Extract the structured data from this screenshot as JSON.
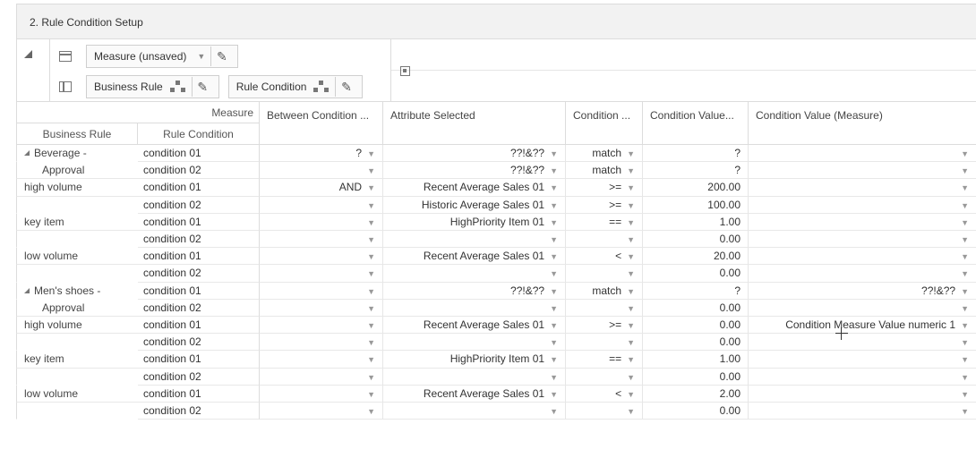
{
  "panel": {
    "title": "2. Rule Condition Setup"
  },
  "pivot": {
    "measure_chip": "Measure (unsaved)",
    "business_rule_chip": "Business Rule",
    "rule_condition_chip": "Rule Condition"
  },
  "header": {
    "measure_label": "Measure",
    "business_rule_label": "Business Rule",
    "rule_condition_label": "Rule Condition",
    "columns": [
      "Between Condition ...",
      "Attribute Selected",
      "Condition ...",
      "Condition Value...",
      "Condition Value (Measure)"
    ]
  },
  "rows": [
    {
      "br": "Beverage -",
      "expand": true,
      "rc": "condition 01",
      "v": [
        "?",
        "??!&??",
        "match",
        "?",
        ""
      ]
    },
    {
      "br": "Approval",
      "expand": false,
      "rc": "condition 02",
      "v": [
        "",
        "??!&??",
        "match",
        "?",
        ""
      ]
    },
    {
      "br": "high volume",
      "expand": false,
      "rc": "condition 01",
      "v": [
        "AND",
        "Recent Average Sales 01",
        ">=",
        "200.00",
        ""
      ]
    },
    {
      "br": "",
      "expand": false,
      "rc": "condition 02",
      "v": [
        "",
        "Historic Average Sales 01",
        ">=",
        "100.00",
        ""
      ]
    },
    {
      "br": "key item",
      "expand": false,
      "rc": "condition 01",
      "v": [
        "",
        "HighPriority Item 01",
        "==",
        "1.00",
        ""
      ]
    },
    {
      "br": "",
      "expand": false,
      "rc": "condition 02",
      "v": [
        "",
        "",
        "",
        "0.00",
        ""
      ]
    },
    {
      "br": "low volume",
      "expand": false,
      "rc": "condition 01",
      "v": [
        "",
        "Recent Average Sales 01",
        "<",
        "20.00",
        ""
      ]
    },
    {
      "br": "",
      "expand": false,
      "rc": "condition 02",
      "v": [
        "",
        "",
        "",
        "0.00",
        ""
      ]
    },
    {
      "br": "Men's shoes -",
      "expand": true,
      "rc": "condition 01",
      "v": [
        "",
        "??!&??",
        "match",
        "?",
        "??!&??"
      ]
    },
    {
      "br": "Approval",
      "expand": false,
      "rc": "condition 02",
      "v": [
        "",
        "",
        "",
        "0.00",
        ""
      ]
    },
    {
      "br": "high volume",
      "expand": false,
      "rc": "condition 01",
      "v": [
        "",
        "Recent Average Sales 01",
        ">=",
        "0.00",
        "Condition Measure Value numeric 1"
      ]
    },
    {
      "br": "",
      "expand": false,
      "rc": "condition 02",
      "v": [
        "",
        "",
        "",
        "0.00",
        ""
      ]
    },
    {
      "br": "key item",
      "expand": false,
      "rc": "condition 01",
      "v": [
        "",
        "HighPriority Item 01",
        "==",
        "1.00",
        ""
      ]
    },
    {
      "br": "",
      "expand": false,
      "rc": "condition 02",
      "v": [
        "",
        "",
        "",
        "0.00",
        ""
      ]
    },
    {
      "br": "low volume",
      "expand": false,
      "rc": "condition 01",
      "v": [
        "",
        "Recent Average Sales 01",
        "<",
        "2.00",
        ""
      ]
    },
    {
      "br": "",
      "expand": false,
      "rc": "condition 02",
      "v": [
        "",
        "",
        "",
        "0.00",
        ""
      ]
    }
  ],
  "icons": {
    "collapse": "collapse-triangle-icon",
    "layout_top": "layout-top-icon",
    "layout_side": "layout-side-icon",
    "hierarchy": "hierarchy-icon",
    "edit": "pencil-icon",
    "filter": "filter-icon",
    "dropdown": "chevron-down-icon"
  }
}
